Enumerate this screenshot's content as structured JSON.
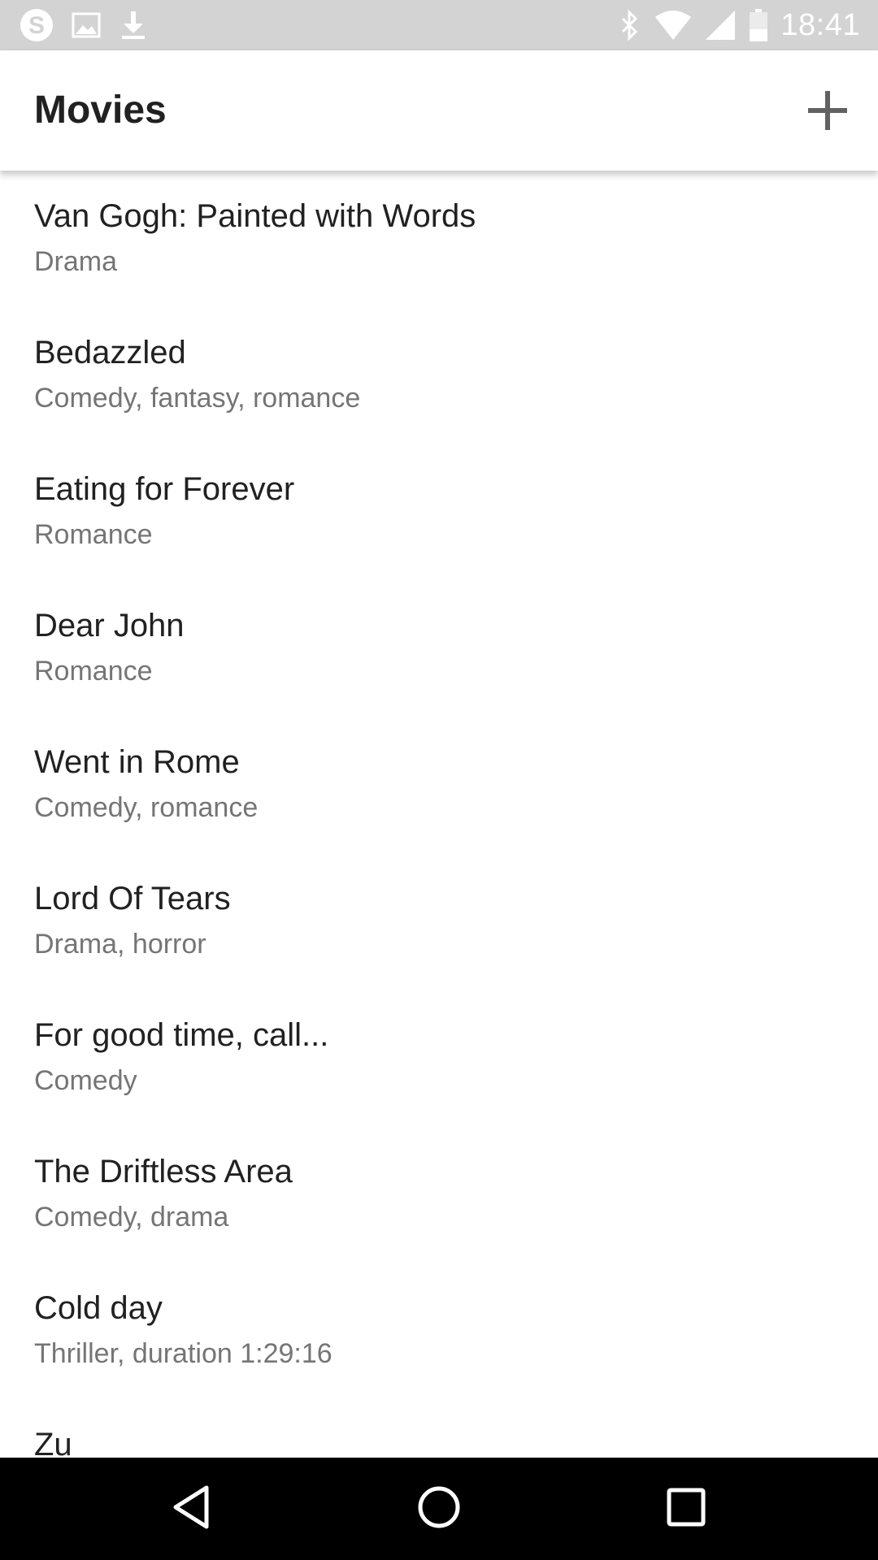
{
  "status_bar": {
    "time": "18:41",
    "left_icons": [
      "skype-icon",
      "image-icon",
      "download-icon"
    ],
    "right_icons": [
      "bluetooth-icon",
      "wifi-icon",
      "signal-icon",
      "battery-icon"
    ]
  },
  "app_bar": {
    "title": "Movies",
    "add_icon": "plus-icon"
  },
  "movies": [
    {
      "title": "Van Gogh: Painted with Words",
      "genre": "Drama"
    },
    {
      "title": "Bedazzled",
      "genre": "Comedy, fantasy, romance"
    },
    {
      "title": "Eating for Forever",
      "genre": "Romance"
    },
    {
      "title": "Dear John",
      "genre": "Romance"
    },
    {
      "title": "Went in Rome",
      "genre": "Comedy, romance"
    },
    {
      "title": "Lord Of Tears",
      "genre": "Drama, horror"
    },
    {
      "title": "For good time, call...",
      "genre": "Comedy"
    },
    {
      "title": "The Driftless Area",
      "genre": "Comedy, drama"
    },
    {
      "title": "Cold day",
      "genre": "Thriller, duration 1:29:16"
    },
    {
      "title": "Zu",
      "genre": ""
    }
  ],
  "nav_bar": {
    "buttons": [
      "back-icon",
      "home-icon",
      "recents-icon"
    ]
  },
  "colors": {
    "status_bar": "#d3d3d3",
    "title_text": "#212121",
    "secondary_text": "#757575",
    "nav_bar": "#000000"
  }
}
